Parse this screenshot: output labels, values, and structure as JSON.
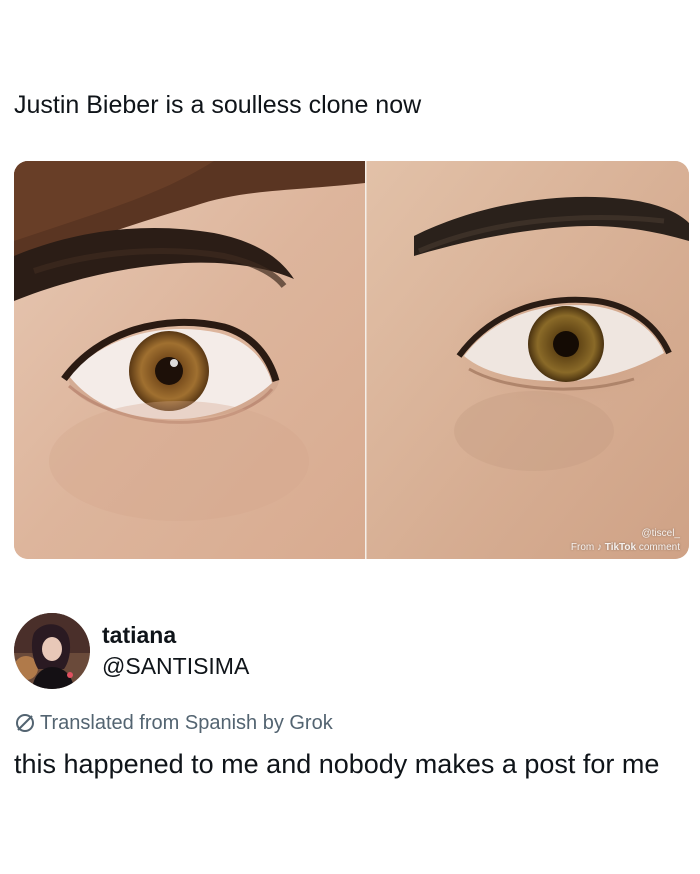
{
  "post": {
    "headline": "Justin Bieber is a soulless clone now"
  },
  "media": {
    "watermark": {
      "handle": "@tiscel_",
      "prefix": "From",
      "brand": "TikTok",
      "suffix": "comment"
    }
  },
  "author": {
    "name": "tatiana",
    "handle": "@SANTISIMA"
  },
  "translation": {
    "label": "Translated from Spanish by Grok"
  },
  "reply": {
    "text": "this happened to me and nobody makes a post for me"
  }
}
